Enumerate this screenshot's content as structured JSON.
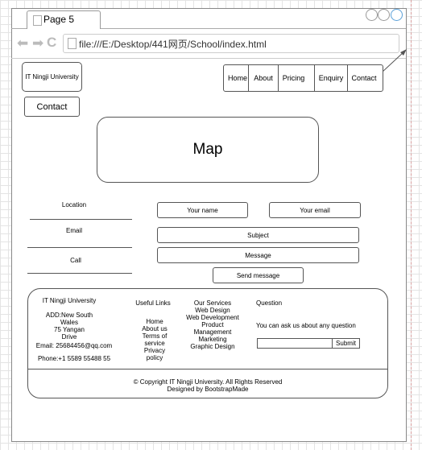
{
  "browser": {
    "tab_title": "Page 5",
    "url": "file:///E:/Desktop/441网页/School/index.html"
  },
  "header": {
    "logo": "IT Ningji University",
    "nav": [
      "Home",
      "About",
      "Pricing",
      "Enquiry",
      "Contact"
    ]
  },
  "page": {
    "contact_button": "Contact",
    "map_label": "Map"
  },
  "contact_info": {
    "location": "Location",
    "email": "Email",
    "call": "Call"
  },
  "form": {
    "name_placeholder": "Your name",
    "email_placeholder": "Your email",
    "subject_placeholder": "Subject",
    "message_placeholder": "Message",
    "send_label": "Send message"
  },
  "footer": {
    "brand": "IT Ningji University",
    "address": [
      "ADD:New South",
      "Wales",
      "75 Yangan",
      "Drive"
    ],
    "email": "Email: 25684456@qq.com",
    "phone": "Phone:+1 5589 55488 55",
    "useful_links_title": "Useful Links",
    "useful_links": [
      "Home",
      "About us",
      "Terms of",
      "service",
      "Privacy",
      "policy"
    ],
    "services_title": "Our Services",
    "services": [
      "Web Design",
      "Web Development",
      "Product",
      "Management",
      "Marketing",
      "Graphic Design"
    ],
    "question_title": "Question",
    "question_text": "You can ask us about any question",
    "submit_label": "Submit",
    "copyright": "© Copyright IT Ningji University. All Rights Reserved",
    "designed_by": "Designed by BootstrapMade"
  }
}
